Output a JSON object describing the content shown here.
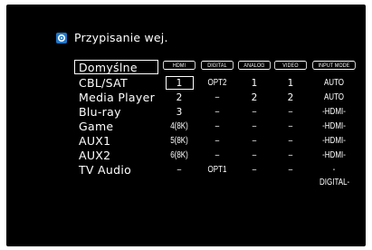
{
  "header": {
    "title": "Przypisanie wej."
  },
  "columns": [
    "HDMI",
    "DIGITAL",
    "ANALOG",
    "VIDEO",
    "INPUT MODE"
  ],
  "rows": [
    {
      "label": "Domyślne",
      "cells": [
        "",
        "",
        "",
        "",
        ""
      ]
    },
    {
      "label": "CBL/SAT",
      "cells": [
        "1",
        "OPT2",
        "1",
        "1",
        "AUTO"
      ]
    },
    {
      "label": "Media Player",
      "cells": [
        "2",
        "–",
        "2",
        "2",
        "AUTO"
      ]
    },
    {
      "label": "Blu-ray",
      "cells": [
        "3",
        "–",
        "–",
        "–",
        "-HDMI-"
      ]
    },
    {
      "label": "Game",
      "cells": [
        "4(8K)",
        "–",
        "–",
        "–",
        "-HDMI-"
      ]
    },
    {
      "label": "AUX1",
      "cells": [
        "5(8K)",
        "–",
        "–",
        "–",
        "-HDMI-"
      ]
    },
    {
      "label": "AUX2",
      "cells": [
        "6(8K)",
        "–",
        "–",
        "–",
        "-HDMI-"
      ]
    },
    {
      "label": "TV Audio",
      "cells": [
        "–",
        "OPT1",
        "–",
        "–",
        "-DIGITAL-"
      ]
    }
  ],
  "colors": {
    "background": "#000000",
    "text": "#ffffff",
    "icon": "#1f76c9"
  },
  "icons": {
    "title": "input-assign-icon"
  }
}
